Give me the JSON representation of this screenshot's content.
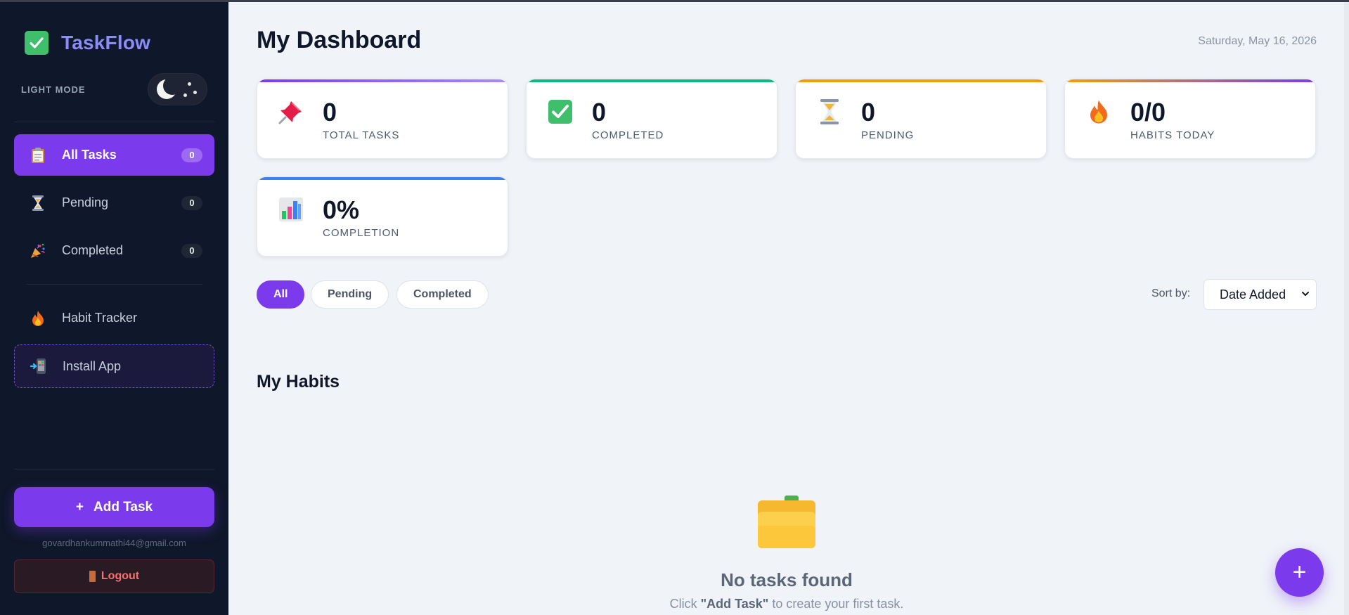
{
  "app": {
    "name": "TaskFlow",
    "brand_color": "#8b8cf7",
    "accent_color": "#7c3aed"
  },
  "theme_toggle": {
    "label": "LIGHT MODE"
  },
  "sidebar": {
    "nav": [
      {
        "label": "All Tasks",
        "count": "0",
        "icon": "clipboard-icon"
      },
      {
        "label": "Pending",
        "count": "0",
        "icon": "hourglass-icon"
      },
      {
        "label": "Completed",
        "count": "0",
        "icon": "party-popper-icon"
      }
    ],
    "habit_tracker": {
      "label": "Habit Tracker",
      "icon": "fire-icon"
    },
    "install": {
      "label": "Install App",
      "icon": "install-app-icon"
    },
    "add_task": {
      "icon": "+",
      "label": "Add Task"
    },
    "email": "govardhankummathi44@gmail.com",
    "logout": "Logout"
  },
  "header": {
    "title": "My Dashboard",
    "date": "Saturday, May 16, 2026"
  },
  "stats": [
    {
      "value": "0",
      "label": "TOTAL TASKS",
      "icon": "pushpin-icon"
    },
    {
      "value": "0",
      "label": "COMPLETED",
      "icon": "check-mark-icon"
    },
    {
      "value": "0",
      "label": "PENDING",
      "icon": "hourglass-icon"
    },
    {
      "value": "0/0",
      "label": "HABITS TODAY",
      "icon": "fire-icon"
    },
    {
      "value": "0%",
      "label": "COMPLETION",
      "icon": "bar-chart-icon"
    }
  ],
  "filters": {
    "chips": [
      "All",
      "Pending",
      "Completed"
    ],
    "active": "All",
    "sort_label": "Sort by:",
    "sort_value": "Date Added"
  },
  "habits": {
    "title": "My Habits"
  },
  "empty_state": {
    "icon": "folder-icon",
    "title": "No tasks found",
    "desc_prefix": "Click ",
    "desc_bold": "\"Add Task\"",
    "desc_suffix": " to create your first task."
  },
  "fab": {
    "label": "+"
  }
}
